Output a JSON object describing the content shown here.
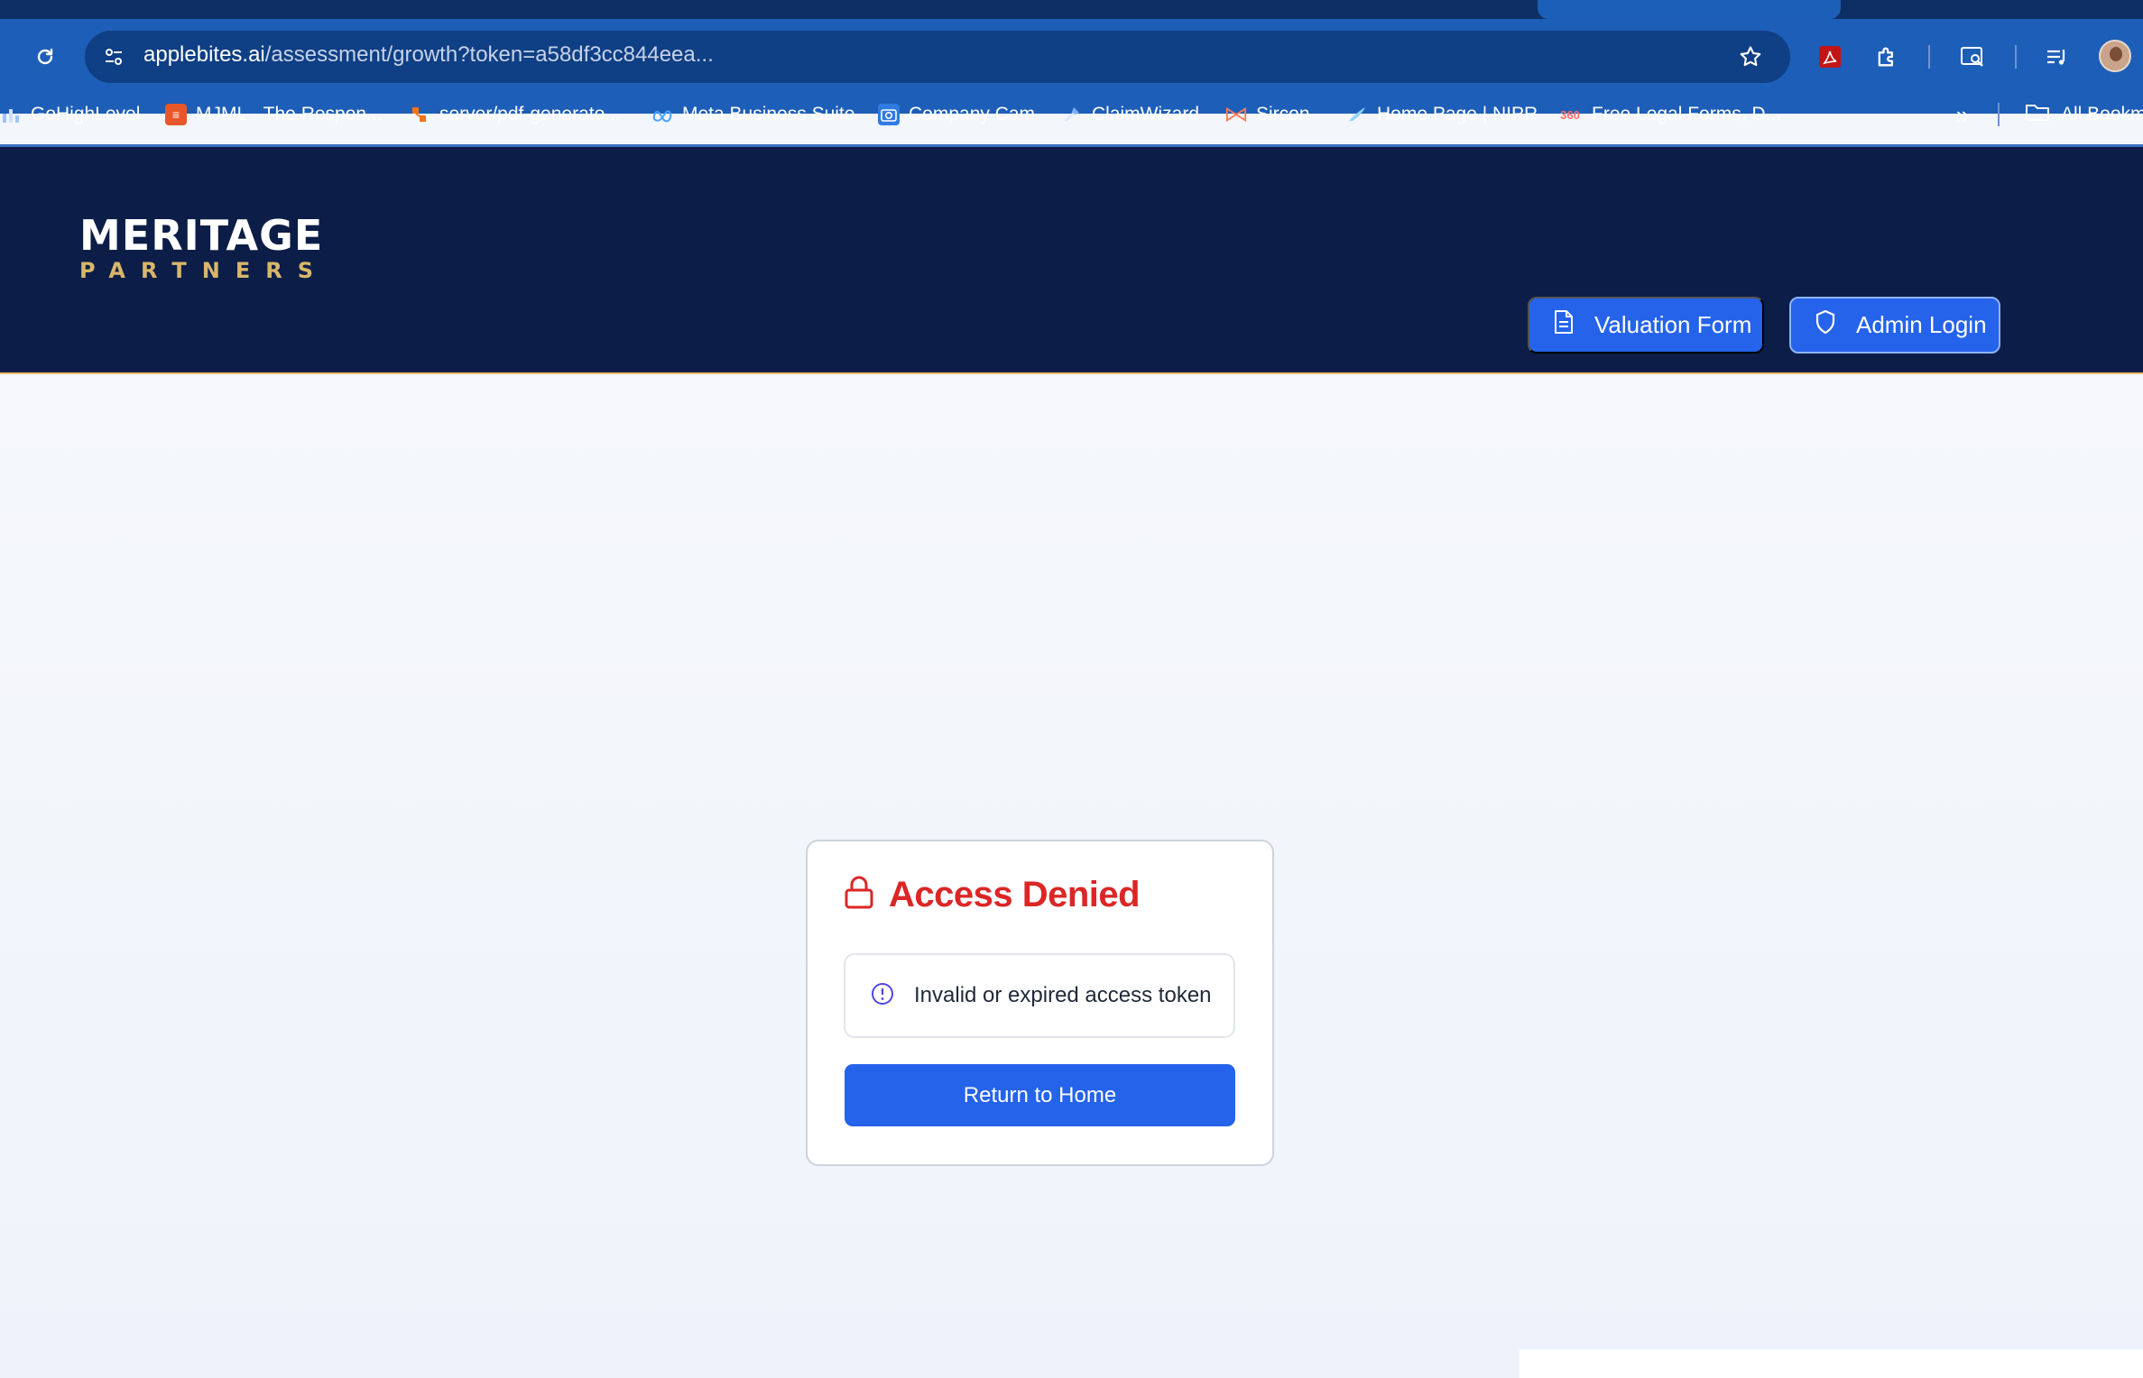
{
  "browser": {
    "url_host": "applebites.ai",
    "url_path": "/assessment/growth?token=a58df3cc844eea...",
    "bookmarks": [
      {
        "label": "GoHighLevel",
        "icon": "gohighlevel-icon"
      },
      {
        "label": "MJML - The Respon...",
        "icon": "mjml-icon"
      },
      {
        "label": "server/pdf-generato...",
        "icon": "git-icon"
      },
      {
        "label": "Meta Business Suite",
        "icon": "meta-icon"
      },
      {
        "label": "Company Cam",
        "icon": "camera-icon"
      },
      {
        "label": "ClaimWizard",
        "icon": "wizard-icon"
      },
      {
        "label": "Sircon",
        "icon": "sircon-icon"
      },
      {
        "label": "Home Page | NIPR",
        "icon": "nipr-icon"
      },
      {
        "label": "Free Legal Forms, D...",
        "icon": "legal-forms-icon"
      }
    ],
    "all_bookmarks_label": "All Bookm"
  },
  "header": {
    "logo_top": "MERITAGE",
    "logo_bottom": "PARTNERS",
    "valuation_label": "Valuation Form",
    "admin_label": "Admin Login"
  },
  "card": {
    "title": "Access Denied",
    "alert_text": "Invalid or expired access token",
    "home_button": "Return to Home"
  },
  "colors": {
    "header_bg": "#0c1e47",
    "primary": "#2563eb",
    "danger": "#dc2626",
    "gold": "#d8b66a"
  }
}
